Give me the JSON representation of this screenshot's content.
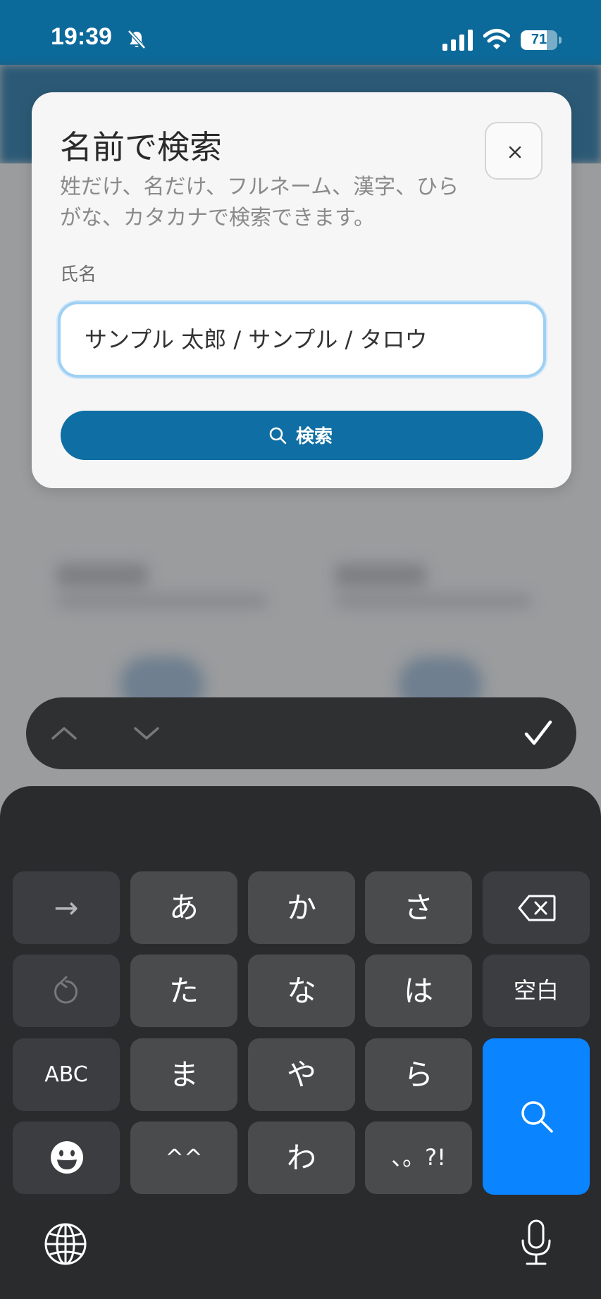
{
  "status_bar": {
    "time": "19:39",
    "battery_level": "71",
    "battery_fraction": 0.71,
    "icons": [
      "bell-slash-icon",
      "signal-icon",
      "wifi-icon",
      "battery-icon"
    ]
  },
  "modal": {
    "title": "名前で検索",
    "description": "姓だけ、名だけ、フルネーム、漢字、ひらがな、カタカナで検索できます。",
    "field_label": "氏名",
    "input_value": "サンプル 太郎 / サンプル / タロウ",
    "search_button_label": "検索",
    "close_icon": "close-icon"
  },
  "toolbar": {
    "icons": [
      "chevron-up-icon",
      "chevron-down-icon",
      "checkmark-icon"
    ]
  },
  "keyboard": {
    "row1": [
      "→",
      "あ",
      "か",
      "さ"
    ],
    "row2": [
      "た",
      "な",
      "は",
      "空白"
    ],
    "row3": [
      "ABC",
      "ま",
      "や",
      "ら"
    ],
    "row4": [
      "^^",
      "わ",
      "、。?!"
    ],
    "icons": [
      "backspace-icon",
      "undo-icon",
      "emoji-icon",
      "search-icon",
      "globe-icon",
      "microphone-icon"
    ],
    "accent_color": "#0a84ff"
  }
}
